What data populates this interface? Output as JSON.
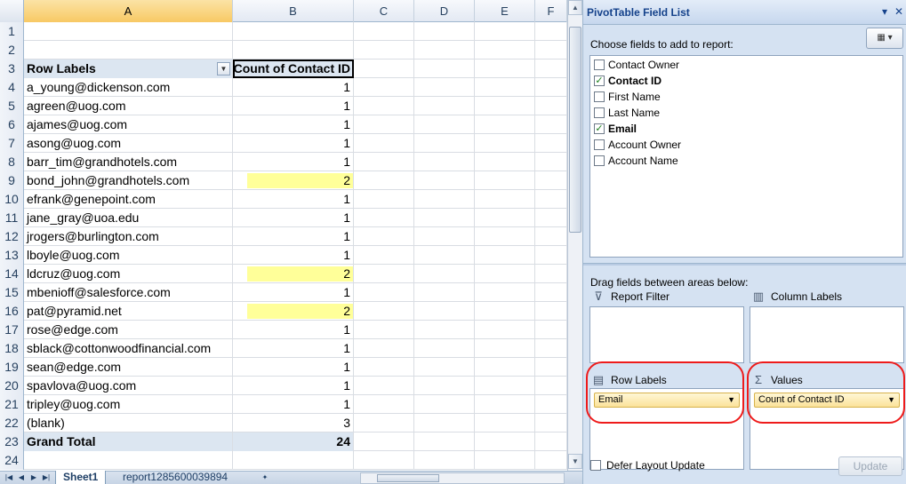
{
  "sheet": {
    "columns": [
      "A",
      "B",
      "C",
      "D",
      "E",
      "F"
    ],
    "header_row": {
      "row": "3",
      "a": "Row Labels",
      "b": "Count of Contact ID"
    },
    "empty_rows": [
      "1",
      "2"
    ],
    "rows": [
      {
        "row": "4",
        "email": "a_young@dickenson.com",
        "count": "1",
        "highlight": false
      },
      {
        "row": "5",
        "email": "agreen@uog.com",
        "count": "1",
        "highlight": false
      },
      {
        "row": "6",
        "email": "ajames@uog.com",
        "count": "1",
        "highlight": false
      },
      {
        "row": "7",
        "email": "asong@uog.com",
        "count": "1",
        "highlight": false
      },
      {
        "row": "8",
        "email": "barr_tim@grandhotels.com",
        "count": "1",
        "highlight": false
      },
      {
        "row": "9",
        "email": "bond_john@grandhotels.com",
        "count": "2",
        "highlight": true
      },
      {
        "row": "10",
        "email": "efrank@genepoint.com",
        "count": "1",
        "highlight": false
      },
      {
        "row": "11",
        "email": "jane_gray@uoa.edu",
        "count": "1",
        "highlight": false
      },
      {
        "row": "12",
        "email": "jrogers@burlington.com",
        "count": "1",
        "highlight": false
      },
      {
        "row": "13",
        "email": "lboyle@uog.com",
        "count": "1",
        "highlight": false
      },
      {
        "row": "14",
        "email": "ldcruz@uog.com",
        "count": "2",
        "highlight": true
      },
      {
        "row": "15",
        "email": "mbenioff@salesforce.com",
        "count": "1",
        "highlight": false
      },
      {
        "row": "16",
        "email": "pat@pyramid.net",
        "count": "2",
        "highlight": true
      },
      {
        "row": "17",
        "email": "rose@edge.com",
        "count": "1",
        "highlight": false
      },
      {
        "row": "18",
        "email": "sblack@cottonwoodfinancial.com",
        "count": "1",
        "highlight": false
      },
      {
        "row": "19",
        "email": "sean@edge.com",
        "count": "1",
        "highlight": false
      },
      {
        "row": "20",
        "email": "spavlova@uog.com",
        "count": "1",
        "highlight": false
      },
      {
        "row": "21",
        "email": "tripley@uog.com",
        "count": "1",
        "highlight": false
      },
      {
        "row": "22",
        "email": "(blank)",
        "count": "3",
        "highlight": false
      }
    ],
    "total_row": {
      "row": "23",
      "a": "Grand Total",
      "b": "24"
    },
    "trailing_rows": [
      "24"
    ],
    "highlight_color": "#ffff99",
    "header_fill": "#dce6f1"
  },
  "tabs": {
    "sheets": [
      "Sheet1",
      "report1285600039894"
    ],
    "active": "Sheet1"
  },
  "pane": {
    "title": "PivotTable Field List",
    "choose_label": "Choose fields to add to report:",
    "fields": [
      {
        "name": "Contact Owner",
        "checked": false
      },
      {
        "name": "Contact ID",
        "checked": true
      },
      {
        "name": "First Name",
        "checked": false
      },
      {
        "name": "Last Name",
        "checked": false
      },
      {
        "name": "Email",
        "checked": true
      },
      {
        "name": "Account Owner",
        "checked": false
      },
      {
        "name": "Account Name",
        "checked": false
      }
    ],
    "drag_label": "Drag fields between areas below:",
    "areas": {
      "report_filter": "Report Filter",
      "column_labels": "Column Labels",
      "row_labels": "Row Labels",
      "values": "Values"
    },
    "row_chip": "Email",
    "values_chip": "Count of Contact ID",
    "defer_label": "Defer Layout Update",
    "update_label": "Update",
    "annotation_color": "#ee1b1b"
  }
}
